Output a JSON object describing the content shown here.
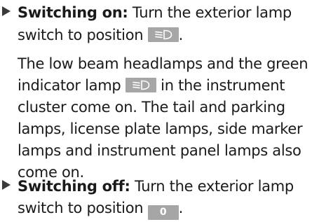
{
  "step_on": {
    "title": "Switching on:",
    "text_a": " Turn the exterior lamp",
    "text_b": "switch to position ",
    "text_c": "."
  },
  "description": {
    "line1": "The low beam headlamps and the green",
    "line2_a": "indicator lamp ",
    "line2_b": " in the instrument",
    "line3": "cluster come on. The tail and parking",
    "line4": "lamps, license plate lamps, side marker",
    "line5": "lamps and instrument panel lamps also",
    "line6": "come on."
  },
  "step_off": {
    "title": "Switching off:",
    "text_a": " Turn the exterior lamp",
    "text_b": "switch to position ",
    "text_c": ".",
    "off_symbol": "0"
  },
  "icons": {
    "bullet": "triangle-right-icon",
    "low_beam": "low-beam-headlamp-icon"
  },
  "colors": {
    "symbol_background": "#a6a6a6",
    "symbol_foreground": "#ffffff"
  }
}
